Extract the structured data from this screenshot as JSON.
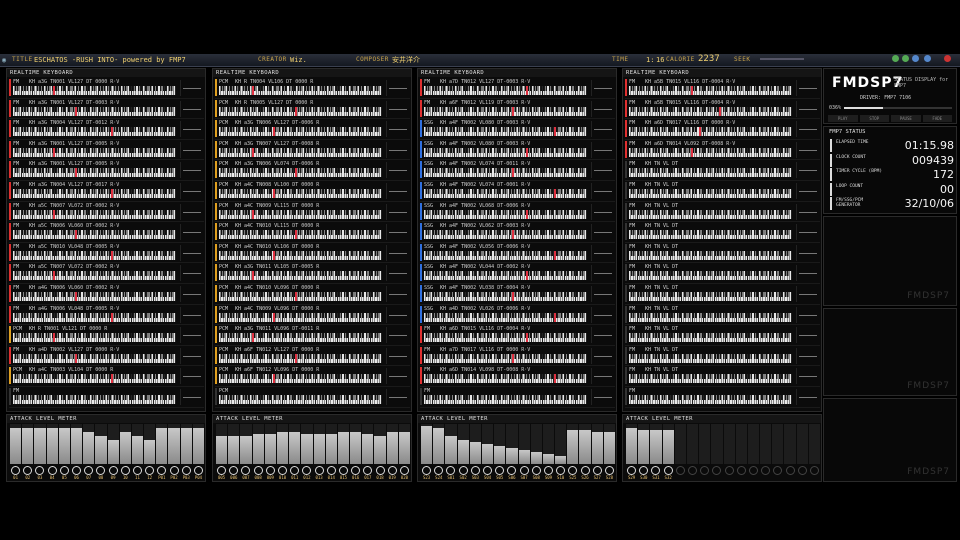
{
  "header": {
    "title_label": "TITLE",
    "title": "ESCHATOS -RUSH INTO- powered by FMP7",
    "creator_label": "CREATOR",
    "creator": "Wiz.",
    "composer_label": "COMPOSER",
    "composer": "安井洋介",
    "time_label": "TIME",
    "time_value": "1:",
    "time_value2": "16",
    "calorie_label": "CALORIE",
    "calorie_value": "2237",
    "seek_label": "SEEK"
  },
  "panels": [
    {
      "title": "REALTIME KEYBOARD",
      "rows": [
        {
          "tag": "FM",
          "info": "KH a3G  TN001 VL127 DT 0000 R·V"
        },
        {
          "tag": "FM",
          "info": "KH a3G  TN001 VL127 DT-0003 R·V"
        },
        {
          "tag": "FM",
          "info": "KH a3G  TN004 VL127 DT-0012 R·V"
        },
        {
          "tag": "FM",
          "info": "KH a3G  TN001 VL127 DT-0005 R·V"
        },
        {
          "tag": "FM",
          "info": "KH a3G  TN001 VL127 DT-0005 R·V"
        },
        {
          "tag": "FM",
          "info": "KH a3G  TN004 VL127 DT-0017 R·V"
        },
        {
          "tag": "FM",
          "info": "KH a5C  TN007 VL072 DT-0002 R·V"
        },
        {
          "tag": "FM",
          "info": "KH a5C  TN006 VL060 DT-0002 R·V"
        },
        {
          "tag": "FM",
          "info": "KH a5C  TN010 VL048 DT-0005 R·V"
        },
        {
          "tag": "FM",
          "info": "KH a5C  TN007 VL072 DT-0002 R·V"
        },
        {
          "tag": "FM",
          "info": "KH a4G  TN006 VL060 DT-0002 R·V"
        },
        {
          "tag": "FM",
          "info": "KH a4G  TN006 VL048 DT-0005 R·V"
        },
        {
          "tag": "PCM",
          "info": "KH R    TN001 VL121 DT 0000 R"
        },
        {
          "tag": "FM",
          "info": "KH a4D  TN002 VL127 DT 0000 R·V"
        },
        {
          "tag": "PCM",
          "info": "KH a4C  TN003 VL104 DT 0000 R"
        },
        {
          "tag": "FM",
          "info": ""
        }
      ],
      "attack_title": "ATTACK LEVEL METER",
      "levels": [
        0.9,
        0.9,
        0.9,
        0.9,
        0.9,
        0.9,
        0.8,
        0.7,
        0.6,
        0.8,
        0.7,
        0.6,
        0.9,
        0.9,
        0.9,
        0.9
      ],
      "channels": [
        "01",
        "02",
        "03",
        "04",
        "05",
        "06",
        "07",
        "08",
        "09",
        "10",
        "11",
        "12",
        "P01",
        "P02",
        "P03",
        "P04"
      ]
    },
    {
      "title": "REALTIME KEYBOARD",
      "rows": [
        {
          "tag": "PCM",
          "info": "KH R    TN004 VL106 DT 0000 R"
        },
        {
          "tag": "PCM",
          "info": "KH R    TN005 VL127 DT 0000 R"
        },
        {
          "tag": "PCM",
          "info": "KH a3G  TN006 VL127 DT-0006 R"
        },
        {
          "tag": "PCM",
          "info": "KH a3G  TN007 VL127 DT-0008 R"
        },
        {
          "tag": "PCM",
          "info": "KH a3G  TN006 VL074 DT-0006 R"
        },
        {
          "tag": "PCM",
          "info": "KH a4C  TN008 VL100 DT 0000 R"
        },
        {
          "tag": "PCM",
          "info": "KH a4C  TN009 VL115 DT 0000 R"
        },
        {
          "tag": "PCM",
          "info": "KH a4C  TN010 VL115 DT 0000 R"
        },
        {
          "tag": "PCM",
          "info": "KH a4C  TN010 VL106 DT 0000 R"
        },
        {
          "tag": "PCM",
          "info": "KH a3G  TN011 VL105 DT-0005 R"
        },
        {
          "tag": "PCM",
          "info": "KH a4C  TN010 VL096 DT 0000 R"
        },
        {
          "tag": "PCM",
          "info": "KH a4C  TN009 VL096 DT 0000 R"
        },
        {
          "tag": "PCM",
          "info": "KH a3G  TN011 VL096 DT-0011 R"
        },
        {
          "tag": "PCM",
          "info": "KH a6F  TN012 VL127 DT 0000 R"
        },
        {
          "tag": "PCM",
          "info": "KH a6F  TN012 VL096 DT 0000 R"
        },
        {
          "tag": "PCM",
          "info": ""
        }
      ],
      "attack_title": "ATTACK LEVEL METER",
      "levels": [
        0.7,
        0.7,
        0.7,
        0.75,
        0.75,
        0.8,
        0.8,
        0.75,
        0.75,
        0.75,
        0.8,
        0.8,
        0.75,
        0.7,
        0.8,
        0.8
      ],
      "channels": [
        "005",
        "006",
        "007",
        "008",
        "009",
        "010",
        "011",
        "012",
        "013",
        "014",
        "015",
        "016",
        "017",
        "018",
        "019",
        "020"
      ]
    },
    {
      "title": "REALTIME KEYBOARD",
      "rows": [
        {
          "tag": "FM",
          "info": "KH a7D  TN012 VL127 DT-0003 R·V"
        },
        {
          "tag": "FM",
          "info": "KH a6F  TN012 VL119 DT-0003 R·V"
        },
        {
          "tag": "SSG",
          "info": "KH a4F  TN002 VL080 DT-0003 R·V"
        },
        {
          "tag": "SSG",
          "info": "KH a4F  TN002 VL080 DT-0003 R·V"
        },
        {
          "tag": "SSG",
          "info": "KH a4F  TN002 VL074 DT-0011 R·V"
        },
        {
          "tag": "SSG",
          "info": "KH a4F  TN002 VL074 DT-0001 R·V"
        },
        {
          "tag": "SSG",
          "info": "KH a4F  TN002 VL068 DT-0006 R·V"
        },
        {
          "tag": "SSG",
          "info": "KH a4F  TN002 VL062 DT-0003 R·V"
        },
        {
          "tag": "SSG",
          "info": "KH a4F  TN002 VL056 DT-0006 R·V"
        },
        {
          "tag": "SSG",
          "info": "KH a4F  TN002 VL044 DT-0002 R·V"
        },
        {
          "tag": "SSG",
          "info": "KH a4F  TN002 VL038 DT-0004 R·V"
        },
        {
          "tag": "SSG",
          "info": "KH a4D  TN002 VL026 DT-0006 R·V"
        },
        {
          "tag": "FM",
          "info": "KH a6D  TN015 VL116 DT-0004 R·V"
        },
        {
          "tag": "FM",
          "info": "KH a7D  TN017 VL116 DT 0000 R·V"
        },
        {
          "tag": "FM",
          "info": "KH a6D  TN014 VL098 DT-0008 R·V"
        },
        {
          "tag": "FM",
          "info": ""
        }
      ],
      "attack_title": "ATTACK LEVEL METER",
      "levels": [
        0.95,
        0.9,
        0.7,
        0.6,
        0.55,
        0.5,
        0.45,
        0.4,
        0.35,
        0.3,
        0.25,
        0.2,
        0.85,
        0.85,
        0.8,
        0.8
      ],
      "channels": [
        "S23",
        "S24",
        "S01",
        "S02",
        "S03",
        "S04",
        "S05",
        "S06",
        "S07",
        "S08",
        "S09",
        "S10",
        "S25",
        "S26",
        "S27",
        "S28"
      ]
    },
    {
      "title": "REALTIME KEYBOARD",
      "rows": [
        {
          "tag": "FM",
          "info": "KH a5B  TN015 VL116 DT-0004 R·V"
        },
        {
          "tag": "FM",
          "info": "KH a5B  TN015 VL116 DT-0004 R·V"
        },
        {
          "tag": "FM",
          "info": "KH a6D  TN017 VL116 DT 0000 R·V"
        },
        {
          "tag": "FM",
          "info": "KH a6D  TN014 VL092 DT-0008 R·V"
        },
        {
          "tag": "FM",
          "info": "KH      TN      VL      DT"
        },
        {
          "tag": "FM",
          "info": "KH      TN      VL      DT"
        },
        {
          "tag": "FM",
          "info": "KH      TN      VL      DT"
        },
        {
          "tag": "FM",
          "info": "KH      TN      VL      DT"
        },
        {
          "tag": "FM",
          "info": "KH      TN      VL      DT"
        },
        {
          "tag": "FM",
          "info": "KH      TN      VL      DT"
        },
        {
          "tag": "FM",
          "info": "KH      TN      VL      DT"
        },
        {
          "tag": "FM",
          "info": "KH      TN      VL      DT"
        },
        {
          "tag": "FM",
          "info": "KH      TN      VL      DT"
        },
        {
          "tag": "FM",
          "info": "KH      TN      VL      DT"
        },
        {
          "tag": "FM",
          "info": "KH      TN      VL      DT"
        },
        {
          "tag": "FM",
          "info": ""
        }
      ],
      "attack_title": "ATTACK LEVEL METER",
      "levels": [
        0.9,
        0.85,
        0.85,
        0.85,
        0,
        0,
        0,
        0,
        0,
        0,
        0,
        0,
        0,
        0,
        0,
        0
      ],
      "channels": [
        "S29",
        "S30",
        "S31",
        "S32",
        "",
        "",
        "",
        "",
        "",
        "",
        "",
        "",
        "",
        "",
        "",
        ""
      ]
    }
  ],
  "status_panel": {
    "logo": "FMDSP7",
    "logo_sub": "STATUS DISPLAY for FMP7",
    "driver": "DRIVER: FMP7 7106",
    "progress": "036%",
    "transport": [
      "PLAY",
      "STOP",
      "PAUSE",
      "FADE"
    ],
    "section_title": "FMP7 STATUS",
    "items": [
      {
        "key": "ELAPSED TIME",
        "value": "01:15.98"
      },
      {
        "key": "CLOCK COUNT",
        "value": "009439"
      },
      {
        "key": "TIMER CYCLE (BPM)",
        "value": "172"
      },
      {
        "key": "LOOP COUNT",
        "value": "00"
      },
      {
        "key": "FM/SSG/PCM GENERATOR",
        "value": "32/10/06"
      }
    ],
    "watermark": "FMDSP7"
  },
  "colors": {
    "fm_bar": "#e03030",
    "pcm_bar": "#e0a020",
    "ssg_bar": "#3070e0",
    "key_hit": "#e03040"
  }
}
